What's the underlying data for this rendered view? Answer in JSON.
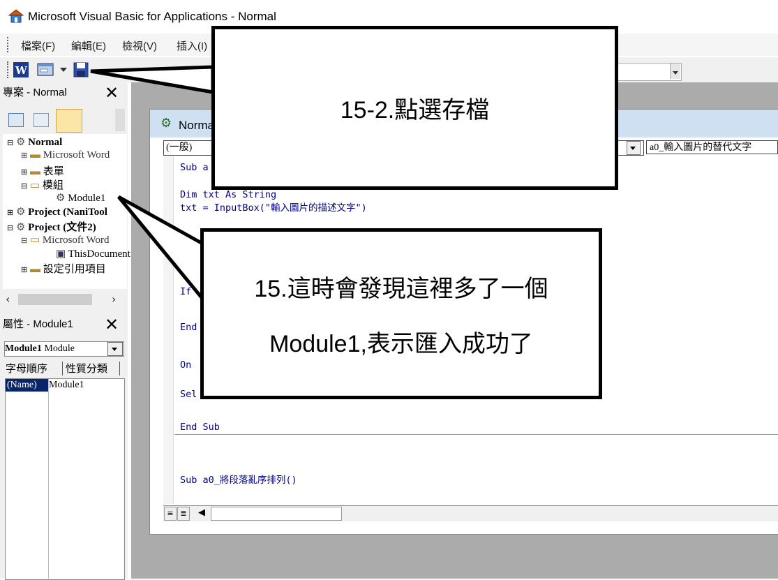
{
  "window": {
    "title": "Microsoft Visual Basic for Applications - Normal"
  },
  "menu": [
    "檔案(F)",
    "編輯(E)",
    "檢視(V)",
    "插入(I)"
  ],
  "project_panel": {
    "title": "專案 - Normal",
    "tree": [
      {
        "label": "Normal",
        "bold": true
      },
      {
        "label": "Microsoft Word"
      },
      {
        "label": "表單"
      },
      {
        "label": "模組"
      },
      {
        "label": "Module1"
      },
      {
        "label": "Project (NaniTool"
      },
      {
        "label": "Project (文件2)",
        "bold": true
      },
      {
        "label": "Microsoft Word"
      },
      {
        "label": "ThisDocument"
      },
      {
        "label": "設定引用項目"
      }
    ]
  },
  "properties_panel": {
    "title": "屬性 - Module1",
    "object_name": "Module1",
    "object_type": "Module",
    "tabs": [
      "字母順序",
      "性質分類"
    ],
    "rows": [
      {
        "name": "(Name)",
        "value": "Module1"
      }
    ]
  },
  "code_window": {
    "title": "Normal",
    "object_dropdown": "(一般)",
    "procedure_dropdown": "a0_輸入圖片的替代文字",
    "lines": [
      "Sub a",
      "Dim txt As String",
      "txt = InputBox(\"輸入圖片的描述文字\")",
      "If",
      "If",
      "End",
      "On",
      "Sel",
      "End Sub",
      "Sub a0_將段落亂序排列()"
    ]
  },
  "callouts": {
    "save": "15-2.點選存檔",
    "module_line1": "15.這時會發現這裡多了一個",
    "module_line2": "Module1,表示匯入成功了"
  }
}
